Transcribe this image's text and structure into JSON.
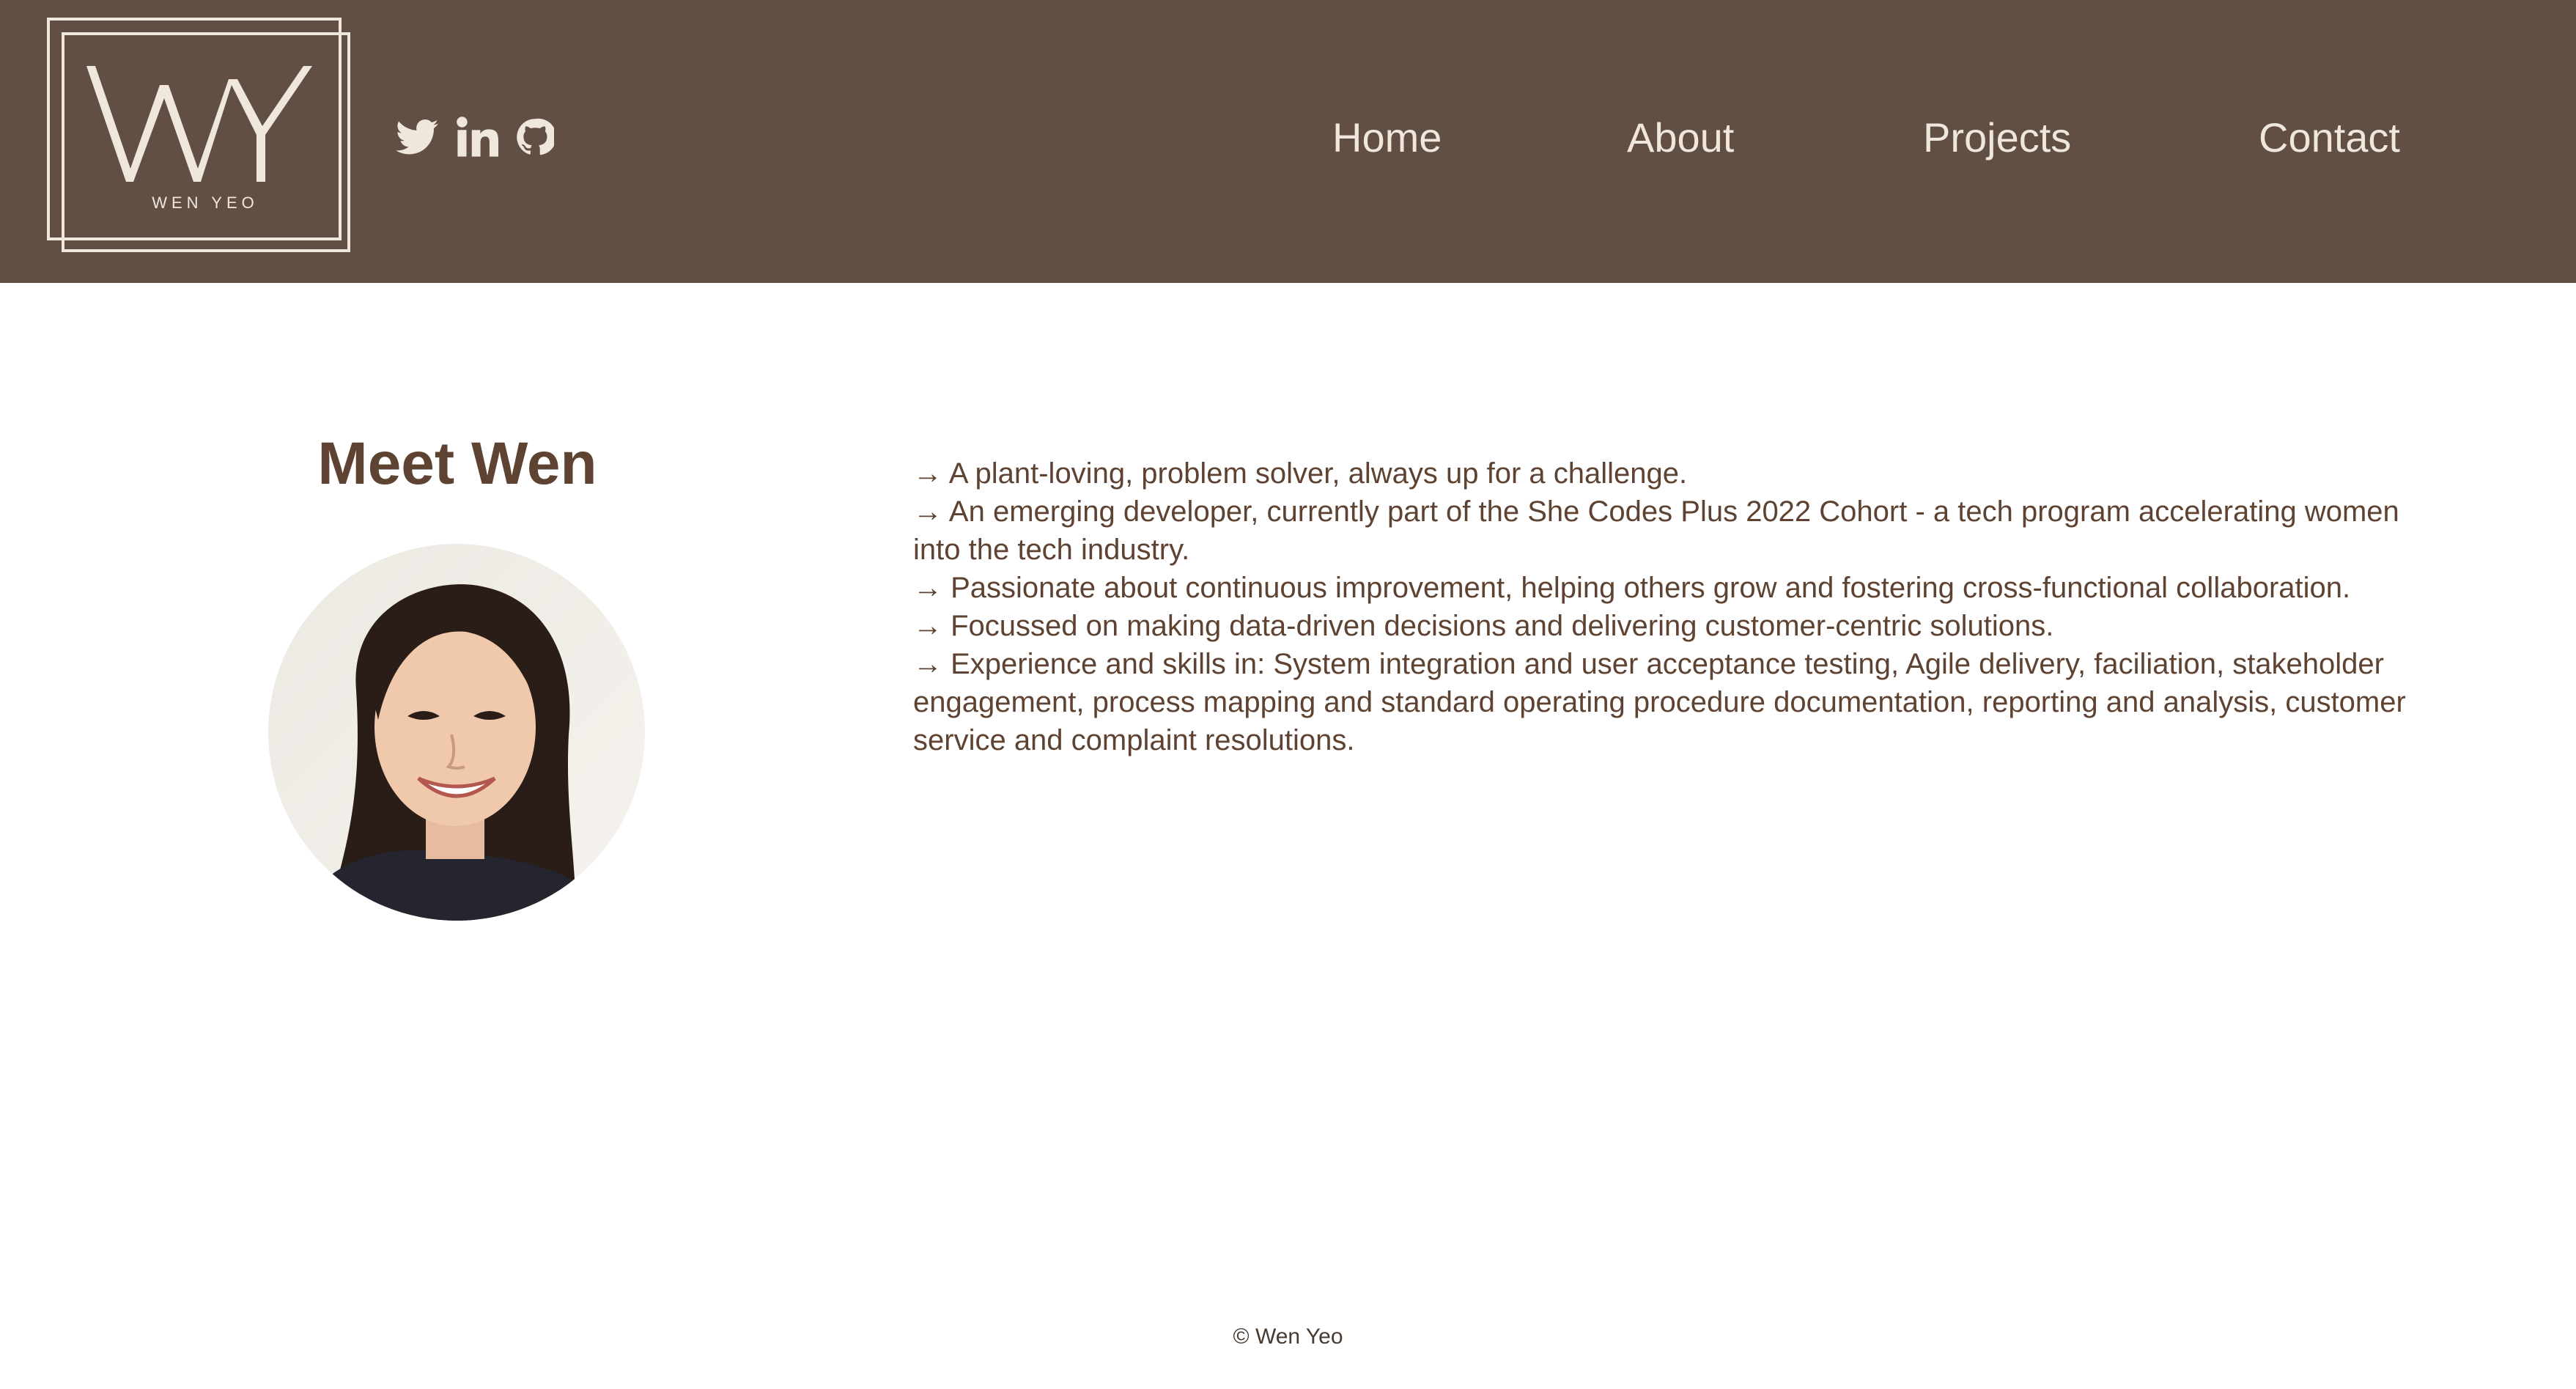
{
  "header": {
    "logo": {
      "monogram": "WY",
      "name": "WEN YEO"
    },
    "social": [
      {
        "name": "twitter-icon",
        "label": "Twitter"
      },
      {
        "name": "linkedin-icon",
        "label": "LinkedIn"
      },
      {
        "name": "github-icon",
        "label": "GitHub"
      }
    ],
    "nav": {
      "home": "Home",
      "about": "About",
      "projects": "Projects",
      "contact": "Contact"
    }
  },
  "about": {
    "title": "Meet Wen",
    "bio": [
      "→ A plant-loving, problem solver, always up for a challenge.",
      "→ An emerging developer, currently part of the She Codes Plus 2022 Cohort - a tech program accelerating women into the tech industry.",
      "→ Passionate about continuous improvement, helping others grow and fostering cross-functional collaboration.",
      "→ Focussed on making data-driven decisions and delivering customer-centric solutions.",
      "→ Experience and skills in: System integration and user acceptance testing, Agile delivery, faciliation, stakeholder engagement, process mapping and standard operating procedure documentation, reporting and analysis, customer service and complaint resolutions."
    ]
  },
  "footer": {
    "copyright": "© Wen Yeo"
  },
  "colors": {
    "header_bg": "#604f42",
    "nav_text": "#efe6dc",
    "heading": "#5e4332",
    "body_text": "#5e4332"
  }
}
